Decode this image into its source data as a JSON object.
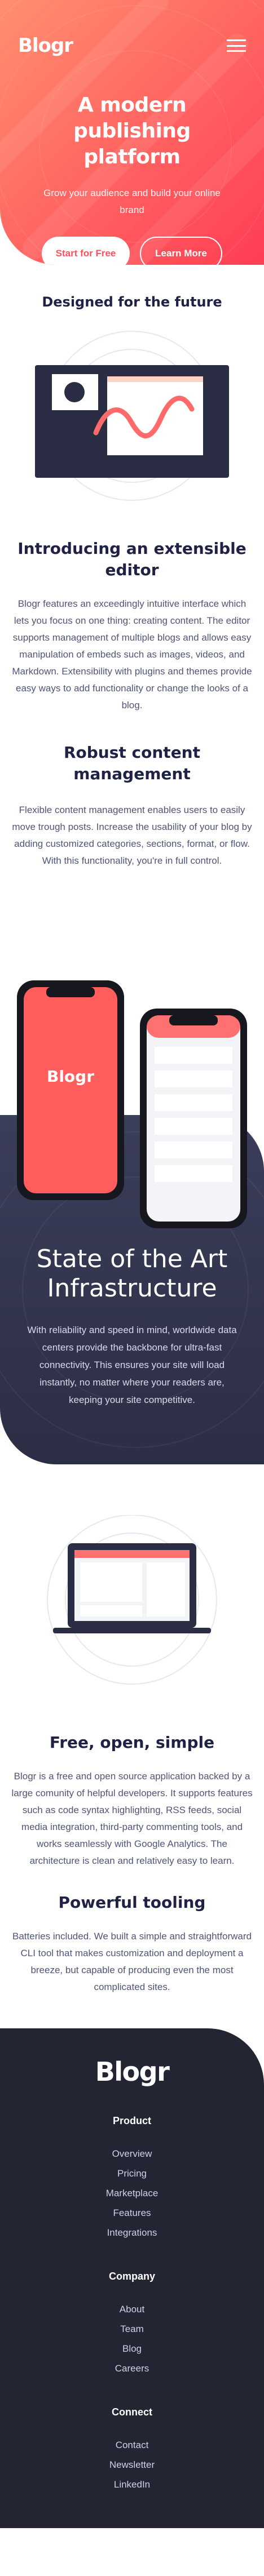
{
  "brand": {
    "logo": "Blogr"
  },
  "hero": {
    "title": "A modern publishing platform",
    "subtitle": "Grow your audience and build your online brand",
    "primary_button": "Start for Free",
    "secondary_button": "Learn More"
  },
  "designed": {
    "title": "Designed for the future",
    "intro_title": "Introducing an extensible editor",
    "intro_text": "Blogr features an exceedingly intuitive interface which lets you focus on one thing: creating content. The editor supports management of multiple blogs and allows easy manipulation of embeds such as images, videos, and Markdown. Extensibility with plugins and themes provide easy ways to add functionality or change the looks of a blog.",
    "robust_title": "Robust content management",
    "robust_text": "Flexible content management enables users to easily move trough posts. Increase the usability of your blog by adding customized categories, sections, format, or flow. With this functionality, you're in full control."
  },
  "phones": {
    "screen_logo": "Blogr"
  },
  "infrastructure": {
    "title": "State of the Art Infrastructure",
    "text": "With reliability and speed in mind, worldwide data centers provide the backbone for ultra-fast connectivity. This ensures your site will load instantly, no matter where your readers are, keeping your site competitive."
  },
  "features": {
    "free_title": "Free, open, simple",
    "free_text": "Blogr is a free and open source application backed by a large comunity of helpful developers. It supports features such as code syntax highlighting, RSS feeds, social media integration, third-party commenting tools, and works seamlessly with Google Analytics. The architecture is clean and relatively easy to learn.",
    "tooling_title": "Powerful tooling",
    "tooling_text": "Batteries included. We built a simple and straightforward CLI tool that makes customization and deployment a breeze, but capable of producing even the most complicated sites."
  },
  "footer": {
    "logo": "Blogr",
    "columns": [
      {
        "heading": "Product",
        "links": [
          "Overview",
          "Pricing",
          "Marketplace",
          "Features",
          "Integrations"
        ]
      },
      {
        "heading": "Company",
        "links": [
          "About",
          "Team",
          "Blog",
          "Careers"
        ]
      },
      {
        "heading": "Connect",
        "links": [
          "Contact",
          "Newsletter",
          "LinkedIn"
        ]
      }
    ]
  },
  "colors": {
    "hero_gradient_start": "#ff8f70",
    "hero_gradient_end": "#ff3d54",
    "dark_blue": "#1f2244",
    "infra_background": "#3b3e59",
    "footer_background": "#232532"
  },
  "icons": {
    "menu": "hamburger-menu-icon"
  }
}
